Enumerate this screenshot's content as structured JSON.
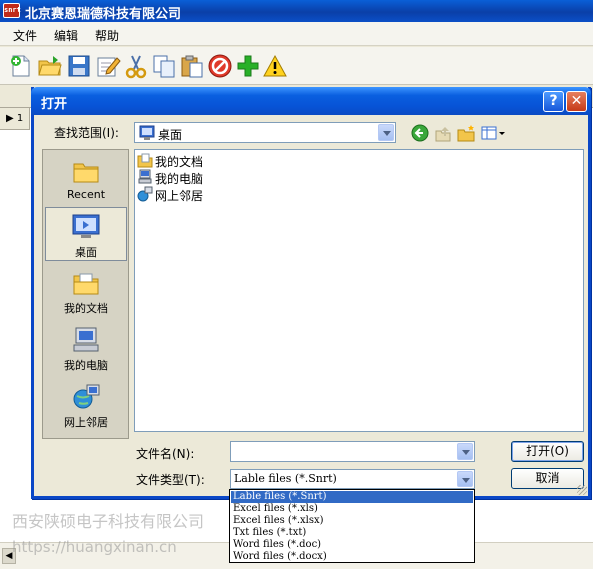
{
  "app": {
    "title": "北京赛恩瑞德科技有限公司",
    "icon_text": "snrt",
    "menu": [
      "文件",
      "编辑",
      "帮助"
    ],
    "toolbar_icons": [
      "new-icon",
      "open-folder-icon",
      "save-icon",
      "edit-icon",
      "cut-icon",
      "copy-icon",
      "paste-icon",
      "stop-icon",
      "add-icon",
      "warning-icon"
    ],
    "row_number": "1"
  },
  "dialog": {
    "title": "打开",
    "help_label": "?",
    "close_label": "✕",
    "lookin_label": "查找范围(I):",
    "lookin_value": "桌面",
    "places": [
      {
        "label": "Recent",
        "icon": "recent-folder-icon"
      },
      {
        "label": "桌面",
        "icon": "desktop-icon"
      },
      {
        "label": "我的文档",
        "icon": "my-documents-icon"
      },
      {
        "label": "我的电脑",
        "icon": "my-computer-icon"
      },
      {
        "label": "网上邻居",
        "icon": "network-places-icon"
      }
    ],
    "files": [
      {
        "name": "我的文档",
        "icon": "my-documents-icon"
      },
      {
        "name": "我的电脑",
        "icon": "my-computer-icon"
      },
      {
        "name": "网上邻居",
        "icon": "network-places-icon"
      }
    ],
    "filename_label": "文件名(N):",
    "filename_value": "",
    "filetype_label": "文件类型(T):",
    "filetype_value": "Lable files (*.Snrt)",
    "open_button": "打开(O)",
    "cancel_button": "取消",
    "filetype_options": [
      "Lable files (*.Snrt)",
      "Excel files (*.xls)",
      "Excel files (*.xlsx)",
      "Txt files (*.txt)",
      "Word files (*.doc)",
      "Word files (*.docx)"
    ],
    "selected_option": "Lable files (*.Snrt)"
  },
  "watermark": {
    "line1": "西安陕硕电子科技有限公司",
    "line2": "https://huangxinan.cn"
  },
  "colors": {
    "title_blue": "#0a5fe0",
    "selection": "#316ac5",
    "dialog_bg": "#ece9d8"
  }
}
